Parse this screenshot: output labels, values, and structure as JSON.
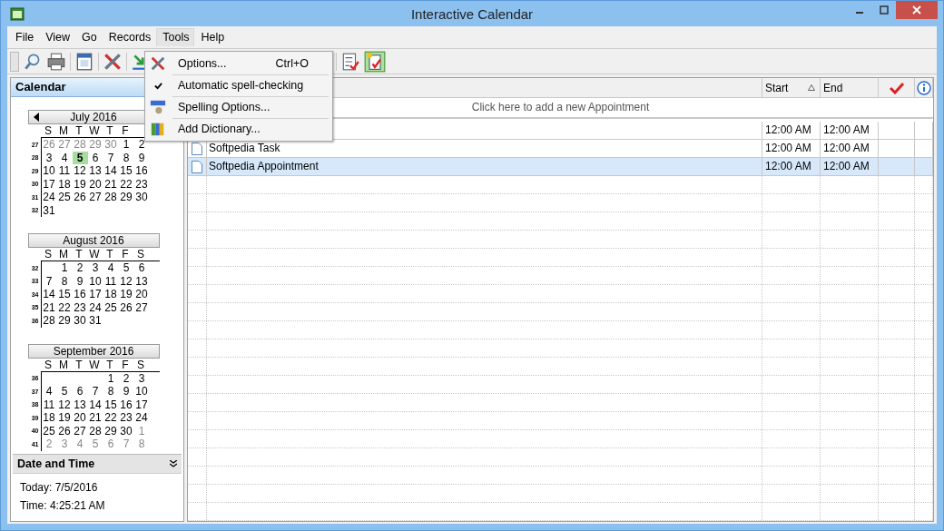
{
  "window": {
    "title": "Interactive Calendar"
  },
  "menu": [
    {
      "label": "File",
      "selected": false
    },
    {
      "label": "View",
      "selected": false
    },
    {
      "label": "Go",
      "selected": false
    },
    {
      "label": "Records",
      "selected": false
    },
    {
      "label": "Tools",
      "selected": true
    },
    {
      "label": "Help",
      "selected": false
    }
  ],
  "dropdown": [
    {
      "kind": "options",
      "label": "Options...",
      "shortcut": "Ctrl+O"
    },
    {
      "kind": "check",
      "label": "Automatic spell-checking",
      "checked": true
    },
    {
      "kind": "spelling",
      "label": "Spelling Options..."
    },
    {
      "kind": "dictionary",
      "label": "Add Dictionary..."
    }
  ],
  "sidebar": {
    "title": "Calendar",
    "months": [
      {
        "title": "July 2016",
        "prev": true,
        "weekdays": [
          "S",
          "M",
          "T",
          "W",
          "T",
          "F"
        ],
        "weeks": [
          {
            "week": "27",
            "days": [
              {
                "n": "26",
                "dim": true,
                "selected": false
              },
              {
                "n": "27",
                "dim": true,
                "selected": false
              },
              {
                "n": "28",
                "dim": true,
                "selected": false
              },
              {
                "n": "29",
                "dim": true,
                "selected": false
              },
              {
                "n": "30",
                "dim": true,
                "selected": false
              },
              {
                "n": "1",
                "dim": false,
                "selected": false
              },
              {
                "n": "2",
                "dim": false,
                "selected": false
              }
            ]
          },
          {
            "week": "28",
            "days": [
              {
                "n": "3",
                "dim": false,
                "selected": false
              },
              {
                "n": "4",
                "dim": false,
                "selected": false
              },
              {
                "n": "5",
                "dim": false,
                "selected": true
              },
              {
                "n": "6",
                "dim": false,
                "selected": false
              },
              {
                "n": "7",
                "dim": false,
                "selected": false
              },
              {
                "n": "8",
                "dim": false,
                "selected": false
              },
              {
                "n": "9",
                "dim": false,
                "selected": false
              }
            ]
          },
          {
            "week": "29",
            "days": [
              {
                "n": "10",
                "dim": false,
                "selected": false
              },
              {
                "n": "11",
                "dim": false,
                "selected": false
              },
              {
                "n": "12",
                "dim": false,
                "selected": false
              },
              {
                "n": "13",
                "dim": false,
                "selected": false
              },
              {
                "n": "14",
                "dim": false,
                "selected": false
              },
              {
                "n": "15",
                "dim": false,
                "selected": false
              },
              {
                "n": "16",
                "dim": false,
                "selected": false
              }
            ]
          },
          {
            "week": "30",
            "days": [
              {
                "n": "17",
                "dim": false,
                "selected": false
              },
              {
                "n": "18",
                "dim": false,
                "selected": false
              },
              {
                "n": "19",
                "dim": false,
                "selected": false
              },
              {
                "n": "20",
                "dim": false,
                "selected": false
              },
              {
                "n": "21",
                "dim": false,
                "selected": false
              },
              {
                "n": "22",
                "dim": false,
                "selected": false
              },
              {
                "n": "23",
                "dim": false,
                "selected": false
              }
            ]
          },
          {
            "week": "31",
            "days": [
              {
                "n": "24",
                "dim": false,
                "selected": false
              },
              {
                "n": "25",
                "dim": false,
                "selected": false
              },
              {
                "n": "26",
                "dim": false,
                "selected": false
              },
              {
                "n": "27",
                "dim": false,
                "selected": false
              },
              {
                "n": "28",
                "dim": false,
                "selected": false
              },
              {
                "n": "29",
                "dim": false,
                "selected": false
              },
              {
                "n": "30",
                "dim": false,
                "selected": false
              }
            ]
          },
          {
            "week": "32",
            "days": [
              {
                "n": "31",
                "dim": false,
                "selected": false
              }
            ]
          }
        ]
      },
      {
        "title": "August 2016",
        "prev": false,
        "weekdays": [
          "S",
          "M",
          "T",
          "W",
          "T",
          "F",
          "S"
        ],
        "weeks": [
          {
            "week": "32",
            "pad_left": true,
            "days": [
              {
                "n": "1",
                "dim": false,
                "selected": false
              },
              {
                "n": "2",
                "dim": false,
                "selected": false
              },
              {
                "n": "3",
                "dim": false,
                "selected": false
              },
              {
                "n": "4",
                "dim": false,
                "selected": false
              },
              {
                "n": "5",
                "dim": false,
                "selected": false
              },
              {
                "n": "6",
                "dim": false,
                "selected": false
              }
            ]
          },
          {
            "week": "33",
            "days": [
              {
                "n": "7",
                "dim": false,
                "selected": false
              },
              {
                "n": "8",
                "dim": false,
                "selected": false
              },
              {
                "n": "9",
                "dim": false,
                "selected": false
              },
              {
                "n": "10",
                "dim": false,
                "selected": false
              },
              {
                "n": "11",
                "dim": false,
                "selected": false
              },
              {
                "n": "12",
                "dim": false,
                "selected": false
              },
              {
                "n": "13",
                "dim": false,
                "selected": false
              }
            ]
          },
          {
            "week": "34",
            "days": [
              {
                "n": "14",
                "dim": false,
                "selected": false
              },
              {
                "n": "15",
                "dim": false,
                "selected": false
              },
              {
                "n": "16",
                "dim": false,
                "selected": false
              },
              {
                "n": "17",
                "dim": false,
                "selected": false
              },
              {
                "n": "18",
                "dim": false,
                "selected": false
              },
              {
                "n": "19",
                "dim": false,
                "selected": false
              },
              {
                "n": "20",
                "dim": false,
                "selected": false
              }
            ]
          },
          {
            "week": "35",
            "days": [
              {
                "n": "21",
                "dim": false,
                "selected": false
              },
              {
                "n": "22",
                "dim": false,
                "selected": false
              },
              {
                "n": "23",
                "dim": false,
                "selected": false
              },
              {
                "n": "24",
                "dim": false,
                "selected": false
              },
              {
                "n": "25",
                "dim": false,
                "selected": false
              },
              {
                "n": "26",
                "dim": false,
                "selected": false
              },
              {
                "n": "27",
                "dim": false,
                "selected": false
              }
            ]
          },
          {
            "week": "36",
            "days": [
              {
                "n": "28",
                "dim": false,
                "selected": false
              },
              {
                "n": "29",
                "dim": false,
                "selected": false
              },
              {
                "n": "30",
                "dim": false,
                "selected": false
              },
              {
                "n": "31",
                "dim": false,
                "selected": false
              }
            ]
          }
        ]
      },
      {
        "title": "September 2016",
        "prev": false,
        "weekdays": [
          "S",
          "M",
          "T",
          "W",
          "T",
          "F",
          "S"
        ],
        "weeks": [
          {
            "week": "36",
            "pad_left": true,
            "days": [
              {
                "n": "1",
                "dim": false,
                "selected": false
              },
              {
                "n": "2",
                "dim": false,
                "selected": false
              },
              {
                "n": "3",
                "dim": false,
                "selected": false
              }
            ]
          },
          {
            "week": "37",
            "days": [
              {
                "n": "4",
                "dim": false,
                "selected": false
              },
              {
                "n": "5",
                "dim": false,
                "selected": false
              },
              {
                "n": "6",
                "dim": false,
                "selected": false
              },
              {
                "n": "7",
                "dim": false,
                "selected": false
              },
              {
                "n": "8",
                "dim": false,
                "selected": false
              },
              {
                "n": "9",
                "dim": false,
                "selected": false
              },
              {
                "n": "10",
                "dim": false,
                "selected": false
              }
            ]
          },
          {
            "week": "38",
            "days": [
              {
                "n": "11",
                "dim": false,
                "selected": false
              },
              {
                "n": "12",
                "dim": false,
                "selected": false
              },
              {
                "n": "13",
                "dim": false,
                "selected": false
              },
              {
                "n": "14",
                "dim": false,
                "selected": false
              },
              {
                "n": "15",
                "dim": false,
                "selected": false
              },
              {
                "n": "16",
                "dim": false,
                "selected": false
              },
              {
                "n": "17",
                "dim": false,
                "selected": false
              }
            ]
          },
          {
            "week": "39",
            "days": [
              {
                "n": "18",
                "dim": false,
                "selected": false
              },
              {
                "n": "19",
                "dim": false,
                "selected": false
              },
              {
                "n": "20",
                "dim": false,
                "selected": false
              },
              {
                "n": "21",
                "dim": false,
                "selected": false
              },
              {
                "n": "22",
                "dim": false,
                "selected": false
              },
              {
                "n": "23",
                "dim": false,
                "selected": false
              },
              {
                "n": "24",
                "dim": false,
                "selected": false
              }
            ]
          },
          {
            "week": "40",
            "days": [
              {
                "n": "25",
                "dim": false,
                "selected": false
              },
              {
                "n": "26",
                "dim": false,
                "selected": false
              },
              {
                "n": "27",
                "dim": false,
                "selected": false
              },
              {
                "n": "28",
                "dim": false,
                "selected": false
              },
              {
                "n": "29",
                "dim": false,
                "selected": false
              },
              {
                "n": "30",
                "dim": false,
                "selected": false
              },
              {
                "n": "1",
                "dim": true,
                "selected": false
              }
            ]
          },
          {
            "week": "41",
            "days": [
              {
                "n": "2",
                "dim": true,
                "selected": false
              },
              {
                "n": "3",
                "dim": true,
                "selected": false
              },
              {
                "n": "4",
                "dim": true,
                "selected": false
              },
              {
                "n": "5",
                "dim": true,
                "selected": false
              },
              {
                "n": "6",
                "dim": true,
                "selected": false
              },
              {
                "n": "7",
                "dim": true,
                "selected": false
              },
              {
                "n": "8",
                "dim": true,
                "selected": false
              }
            ]
          }
        ]
      }
    ]
  },
  "date_time": {
    "title": "Date and Time",
    "today": "Today: 7/5/2016",
    "time": "Time: 4:25:21 AM"
  },
  "table": {
    "columns": [
      "Start",
      "End"
    ],
    "new_row": "Click here to add a new Appointment",
    "rows": [
      {
        "start": "12:00 AM",
        "end": "12:00 AM",
        "selected": false
      },
      {
        "subject": "Softpedia Task",
        "start": "12:00 AM",
        "end": "12:00 AM",
        "selected": false
      },
      {
        "subject": "Softpedia Appointment",
        "start": "12:00 AM",
        "end": "12:00 AM",
        "selected": true
      }
    ]
  }
}
